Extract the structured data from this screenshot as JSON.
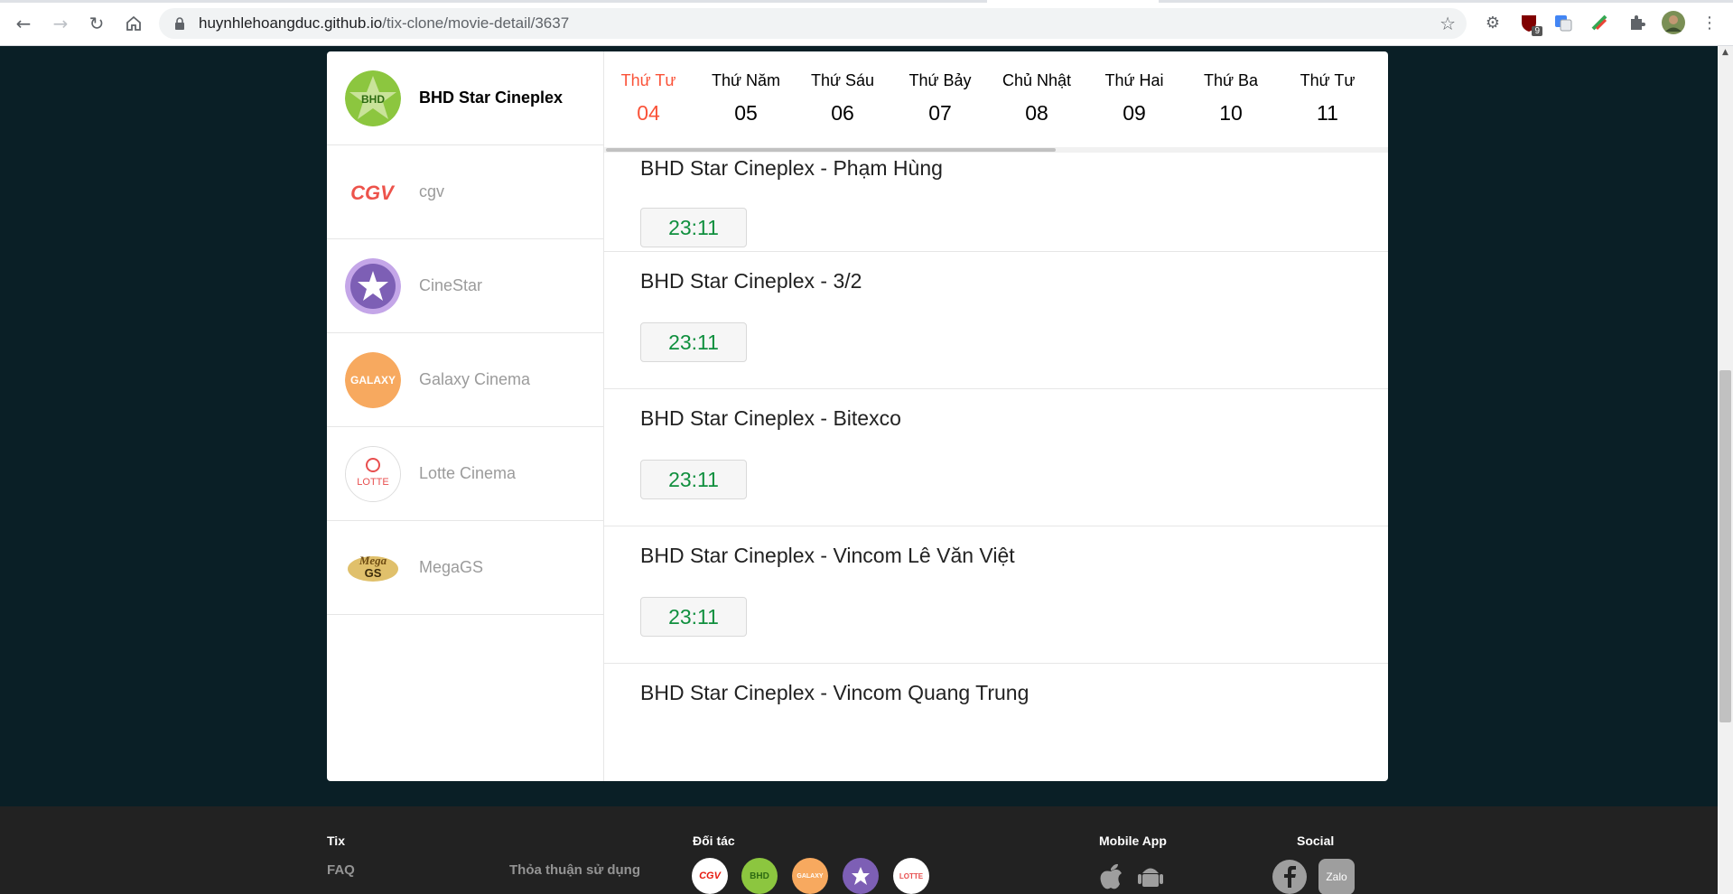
{
  "browser": {
    "url_host": "huynhlehoangduc.github.io",
    "url_path": "/tix-clone/movie-detail/3637",
    "extension_badge": "9"
  },
  "cinemas": [
    {
      "name": "BHD Star Cineplex",
      "active": true,
      "logo": "bhd-logo"
    },
    {
      "name": "cgv",
      "active": false,
      "logo": "cgv-logo"
    },
    {
      "name": "CineStar",
      "active": false,
      "logo": "cinestar-logo"
    },
    {
      "name": "Galaxy Cinema",
      "active": false,
      "logo": "galaxy-logo"
    },
    {
      "name": "Lotte Cinema",
      "active": false,
      "logo": "lotte-logo"
    },
    {
      "name": "MegaGS",
      "active": false,
      "logo": "megags-logo"
    }
  ],
  "dates": [
    {
      "day": "Thứ Tư",
      "num": "04",
      "active": true
    },
    {
      "day": "Thứ Năm",
      "num": "05"
    },
    {
      "day": "Thứ Sáu",
      "num": "06"
    },
    {
      "day": "Thứ Bảy",
      "num": "07"
    },
    {
      "day": "Chủ Nhật",
      "num": "08"
    },
    {
      "day": "Thứ Hai",
      "num": "09"
    },
    {
      "day": "Thứ Ba",
      "num": "10"
    },
    {
      "day": "Thứ Tư",
      "num": "11"
    }
  ],
  "theaters": [
    {
      "name": "BHD Star Cineplex - Phạm Hùng",
      "showtime": "23:11"
    },
    {
      "name": "BHD Star Cineplex - 3/2",
      "showtime": "23:11"
    },
    {
      "name": "BHD Star Cineplex - Bitexco",
      "showtime": "23:11"
    },
    {
      "name": "BHD Star Cineplex - Vincom Lê Văn Việt",
      "showtime": "23:11"
    },
    {
      "name": "BHD Star Cineplex - Vincom Quang Trung",
      "showtime": ""
    }
  ],
  "footer": {
    "tix_heading": "Tix",
    "faq": "FAQ",
    "terms": "Thỏa thuận sử dụng",
    "partners_heading": "Đối tác",
    "partner_labels": {
      "cgv": "CGV",
      "bhd": "BHD",
      "galaxy": "GALAXY",
      "lotte": "LOTTE"
    },
    "mobile_heading": "Mobile App",
    "social_heading": "Social",
    "zalo": "Zalo"
  },
  "colors": {
    "active_date": "#fa5238",
    "showtime": "#108f3e",
    "page_bg": "#0a1f26",
    "footer_bg": "#222222"
  }
}
